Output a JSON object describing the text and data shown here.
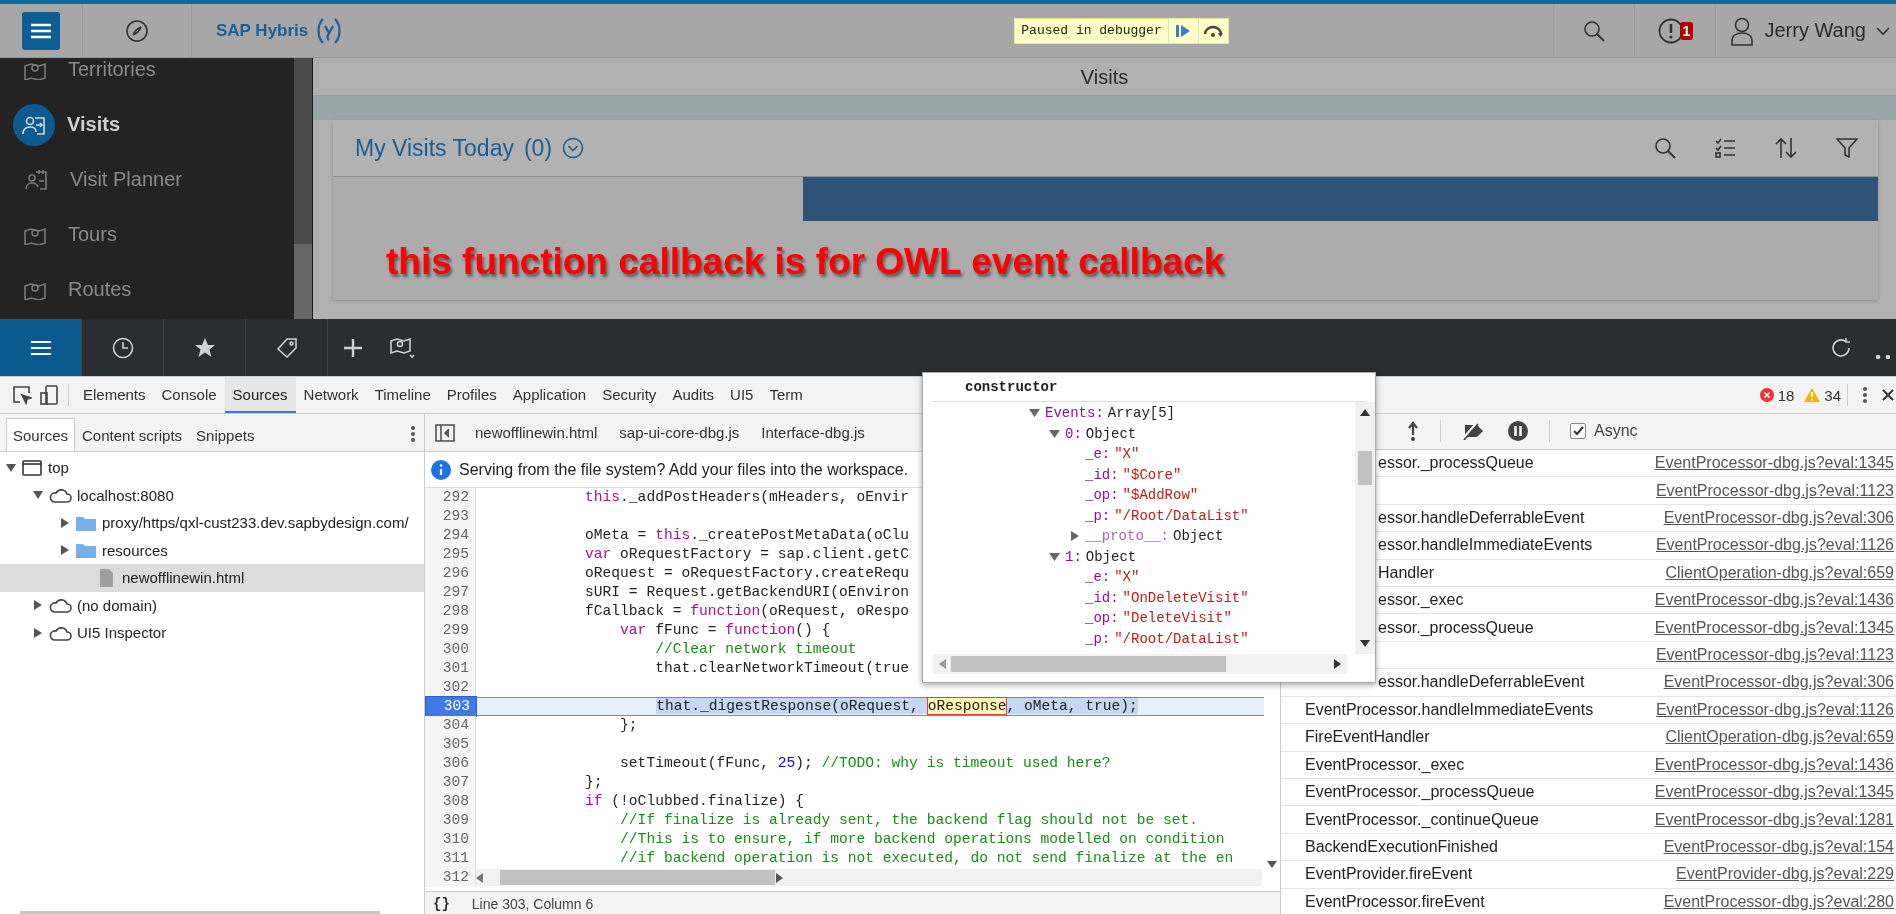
{
  "top_bar": {
    "logo": "SAP Hybris",
    "debugger_badge": "Paused in debugger",
    "notification_count": "1",
    "user": "Jerry Wang"
  },
  "sidebar": {
    "items": [
      {
        "label": "Territories",
        "selected": false
      },
      {
        "label": "Visits",
        "selected": true
      },
      {
        "label": "Visit Planner",
        "selected": false
      },
      {
        "label": "Tours",
        "selected": false
      },
      {
        "label": "Routes",
        "selected": false
      }
    ]
  },
  "page": {
    "title": "Visits",
    "card_title": "My Visits Today",
    "card_count": "(0)",
    "annotation": "this function callback is for OWL event callback"
  },
  "devtools": {
    "tabs": [
      {
        "label": "Elements",
        "selected": false
      },
      {
        "label": "Console",
        "selected": false
      },
      {
        "label": "Sources",
        "selected": true
      },
      {
        "label": "Network",
        "selected": false
      },
      {
        "label": "Timeline",
        "selected": false
      },
      {
        "label": "Profiles",
        "selected": false
      },
      {
        "label": "Application",
        "selected": false
      },
      {
        "label": "Security",
        "selected": false
      },
      {
        "label": "Audits",
        "selected": false
      },
      {
        "label": "UI5",
        "selected": false
      },
      {
        "label": "Term",
        "selected": false
      }
    ],
    "error_count": "18",
    "warning_count": "34",
    "navigator": {
      "tabs": [
        {
          "label": "Sources",
          "selected": true
        },
        {
          "label": "Content scripts",
          "selected": false
        },
        {
          "label": "Snippets",
          "selected": false
        }
      ],
      "tree": [
        {
          "label": "top",
          "kind": "frame",
          "expanded": true,
          "selected": false,
          "children": [
            {
              "label": "localhost:8080",
              "kind": "domain",
              "expanded": true,
              "selected": false,
              "children": [
                {
                  "label": "proxy/https/qxl-cust233.dev.sapbydesign.com/",
                  "kind": "folder",
                  "expanded": false,
                  "selected": false
                },
                {
                  "label": "resources",
                  "kind": "folder",
                  "expanded": false,
                  "selected": false
                },
                {
                  "label": "newofflinewin.html",
                  "kind": "file",
                  "selected": true
                }
              ]
            },
            {
              "label": "(no domain)",
              "kind": "domain",
              "expanded": false,
              "selected": false
            },
            {
              "label": "UI5 Inspector",
              "kind": "domain",
              "expanded": false,
              "selected": false
            }
          ]
        }
      ]
    },
    "editor": {
      "tabs": [
        "newofflinewin.html",
        "sap-ui-core-dbg.js",
        "Interface-dbg.js"
      ],
      "info": "Serving from the file system? Add your files into the workspace.",
      "lines": [
        {
          "number": "292",
          "current": false,
          "segments": [
            {
              "kind": "keyword",
              "text": "            this"
            },
            {
              "kind": "plain",
              "text": "._addPostHeaders(mHeaders, oEnvir"
            }
          ]
        },
        {
          "number": "293",
          "current": false
        },
        {
          "number": "294",
          "current": false,
          "segments": [
            {
              "kind": "plain",
              "text": "            oMeta = "
            },
            {
              "kind": "keyword",
              "text": "this"
            },
            {
              "kind": "plain",
              "text": "._createPostMetaData(oClu"
            }
          ]
        },
        {
          "number": "295",
          "current": false,
          "segments": [
            {
              "kind": "keyword",
              "text": "            var"
            },
            {
              "kind": "plain",
              "text": " oRequestFactory = sap.client.getC"
            }
          ]
        },
        {
          "number": "296",
          "current": false,
          "segments": [
            {
              "kind": "plain",
              "text": "            oRequest = oRequestFactory.createRequ"
            }
          ]
        },
        {
          "number": "297",
          "current": false,
          "segments": [
            {
              "kind": "plain",
              "text": "            sURI = Request.getBackendURI(oEnviron"
            }
          ]
        },
        {
          "number": "298",
          "current": false,
          "segments": [
            {
              "kind": "plain",
              "text": "            fCallback = "
            },
            {
              "kind": "keyword",
              "text": "function"
            },
            {
              "kind": "plain",
              "text": "(oRequest, oRespo"
            }
          ]
        },
        {
          "number": "299",
          "current": false,
          "segments": [
            {
              "kind": "keyword",
              "text": "                var"
            },
            {
              "kind": "plain",
              "text": " fFunc = "
            },
            {
              "kind": "keyword",
              "text": "function"
            },
            {
              "kind": "plain",
              "text": "() {"
            }
          ]
        },
        {
          "number": "300",
          "current": false,
          "segments": [
            {
              "kind": "comment",
              "text": "                    //Clear network timeout"
            }
          ]
        },
        {
          "number": "301",
          "current": false,
          "segments": [
            {
              "kind": "plain",
              "text": "                    that.clearNetworkTimeout(true"
            }
          ]
        },
        {
          "number": "302",
          "current": false
        },
        {
          "number": "303",
          "current": true,
          "segments": [
            {
              "kind": "selected",
              "text": "                    that._digestResponse(oRequest, "
            },
            {
              "kind": "hover",
              "text": "oResponse"
            },
            {
              "kind": "selected",
              "text": ", oMeta, true);"
            }
          ]
        },
        {
          "number": "304",
          "current": false,
          "segments": [
            {
              "kind": "plain",
              "text": "                };"
            }
          ]
        },
        {
          "number": "305",
          "current": false
        },
        {
          "number": "306",
          "current": false,
          "segments": [
            {
              "kind": "plain",
              "text": "                setTimeout(fFunc, "
            },
            {
              "kind": "number",
              "text": "25"
            },
            {
              "kind": "plain",
              "text": "); "
            },
            {
              "kind": "comment",
              "text": "//TODO: why is timeout used here?"
            }
          ]
        },
        {
          "number": "307",
          "current": false,
          "segments": [
            {
              "kind": "plain",
              "text": "            };"
            }
          ]
        },
        {
          "number": "308",
          "current": false,
          "segments": [
            {
              "kind": "keyword",
              "text": "            if"
            },
            {
              "kind": "plain",
              "text": " (!oClubbed.finalize) {"
            }
          ]
        },
        {
          "number": "309",
          "current": false,
          "segments": [
            {
              "kind": "comment",
              "text": "                //If finalize is already sent, the backend flag should not be set."
            }
          ]
        },
        {
          "number": "310",
          "current": false,
          "segments": [
            {
              "kind": "comment",
              "text": "                //This is to ensure, if more backend operations modelled on condition"
            }
          ]
        },
        {
          "number": "311",
          "current": false,
          "segments": [
            {
              "kind": "comment",
              "text": "                //if backend operation is not executed, do not send finalize at the en"
            }
          ]
        },
        {
          "number": "312",
          "current": false
        }
      ],
      "format_button": "{}",
      "status": "Line 303, Column 6"
    },
    "debugger": {
      "async": {
        "label": "Async",
        "checked": true
      },
      "frames_behind_popup": [
        {
          "function": "essor._processQueue",
          "location": "EventProcessor-dbg.js?eval:1345"
        },
        {
          "location": "EventProcessor-dbg.js?eval:1123"
        },
        {
          "function": "essor.handleDeferrableEvent",
          "location": "EventProcessor-dbg.js?eval:306"
        },
        {
          "function": "essor.handleImmediateEvents",
          "location": "EventProcessor-dbg.js?eval:1126"
        },
        {
          "function": "Handler",
          "location": "ClientOperation-dbg.js?eval:659"
        },
        {
          "function": "essor._exec",
          "location": "EventProcessor-dbg.js?eval:1436"
        },
        {
          "function": "essor._processQueue",
          "location": "EventProcessor-dbg.js?eval:1345"
        },
        {
          "location": "EventProcessor-dbg.js?eval:1123"
        },
        {
          "function": "essor.handleDeferrableEvent",
          "location": "EventProcessor-dbg.js?eval:306"
        }
      ],
      "frames": [
        {
          "function": "EventProcessor.handleImmediateEvents",
          "location": "EventProcessor-dbg.js?eval:1126"
        },
        {
          "function": "FireEventHandler",
          "location": "ClientOperation-dbg.js?eval:659"
        },
        {
          "function": "EventProcessor._exec",
          "location": "EventProcessor-dbg.js?eval:1436"
        },
        {
          "function": "EventProcessor._processQueue",
          "location": "EventProcessor-dbg.js?eval:1345"
        },
        {
          "function": "EventProcessor._continueQueue",
          "location": "EventProcessor-dbg.js?eval:1281"
        },
        {
          "function": "BackendExecutionFinished",
          "location": "EventProcessor-dbg.js?eval:154"
        },
        {
          "function": "EventProvider.fireEvent",
          "location": "EventProvider-dbg.js?eval:229"
        },
        {
          "function": "EventProcessor.fireEvent",
          "location": "EventProcessor-dbg.js?eval:280"
        }
      ]
    },
    "popup": {
      "title": "constructor",
      "tree": [
        {
          "key": "Events:",
          "value": "Array[5]",
          "kind": "object",
          "expanded": true,
          "children": [
            {
              "key": "0:",
              "value": "Object",
              "kind": "object",
              "expanded": true,
              "children": [
                {
                  "key": "_e:",
                  "value": "\"X\"",
                  "kind": "string"
                },
                {
                  "key": "_id:",
                  "value": "\"$Core\"",
                  "kind": "string"
                },
                {
                  "key": "_op:",
                  "value": "\"$AddRow\"",
                  "kind": "string"
                },
                {
                  "key": "_p:",
                  "value": "\"/Root/DataList\"",
                  "kind": "string"
                },
                {
                  "key": "__proto__:",
                  "value": "Object",
                  "kind": "object",
                  "expanded": false
                }
              ]
            },
            {
              "key": "1:",
              "value": "Object",
              "kind": "object",
              "expanded": true,
              "children": [
                {
                  "key": "_e:",
                  "value": "\"X\"",
                  "kind": "string"
                },
                {
                  "key": "_id:",
                  "value": "\"OnDeleteVisit\"",
                  "kind": "string"
                },
                {
                  "key": "_op:",
                  "value": "\"DeleteVisit\"",
                  "kind": "string"
                },
                {
                  "key": "_p:",
                  "value": "\"/Root/DataList\"",
                  "kind": "string"
                }
              ]
            }
          ]
        }
      ]
    }
  }
}
